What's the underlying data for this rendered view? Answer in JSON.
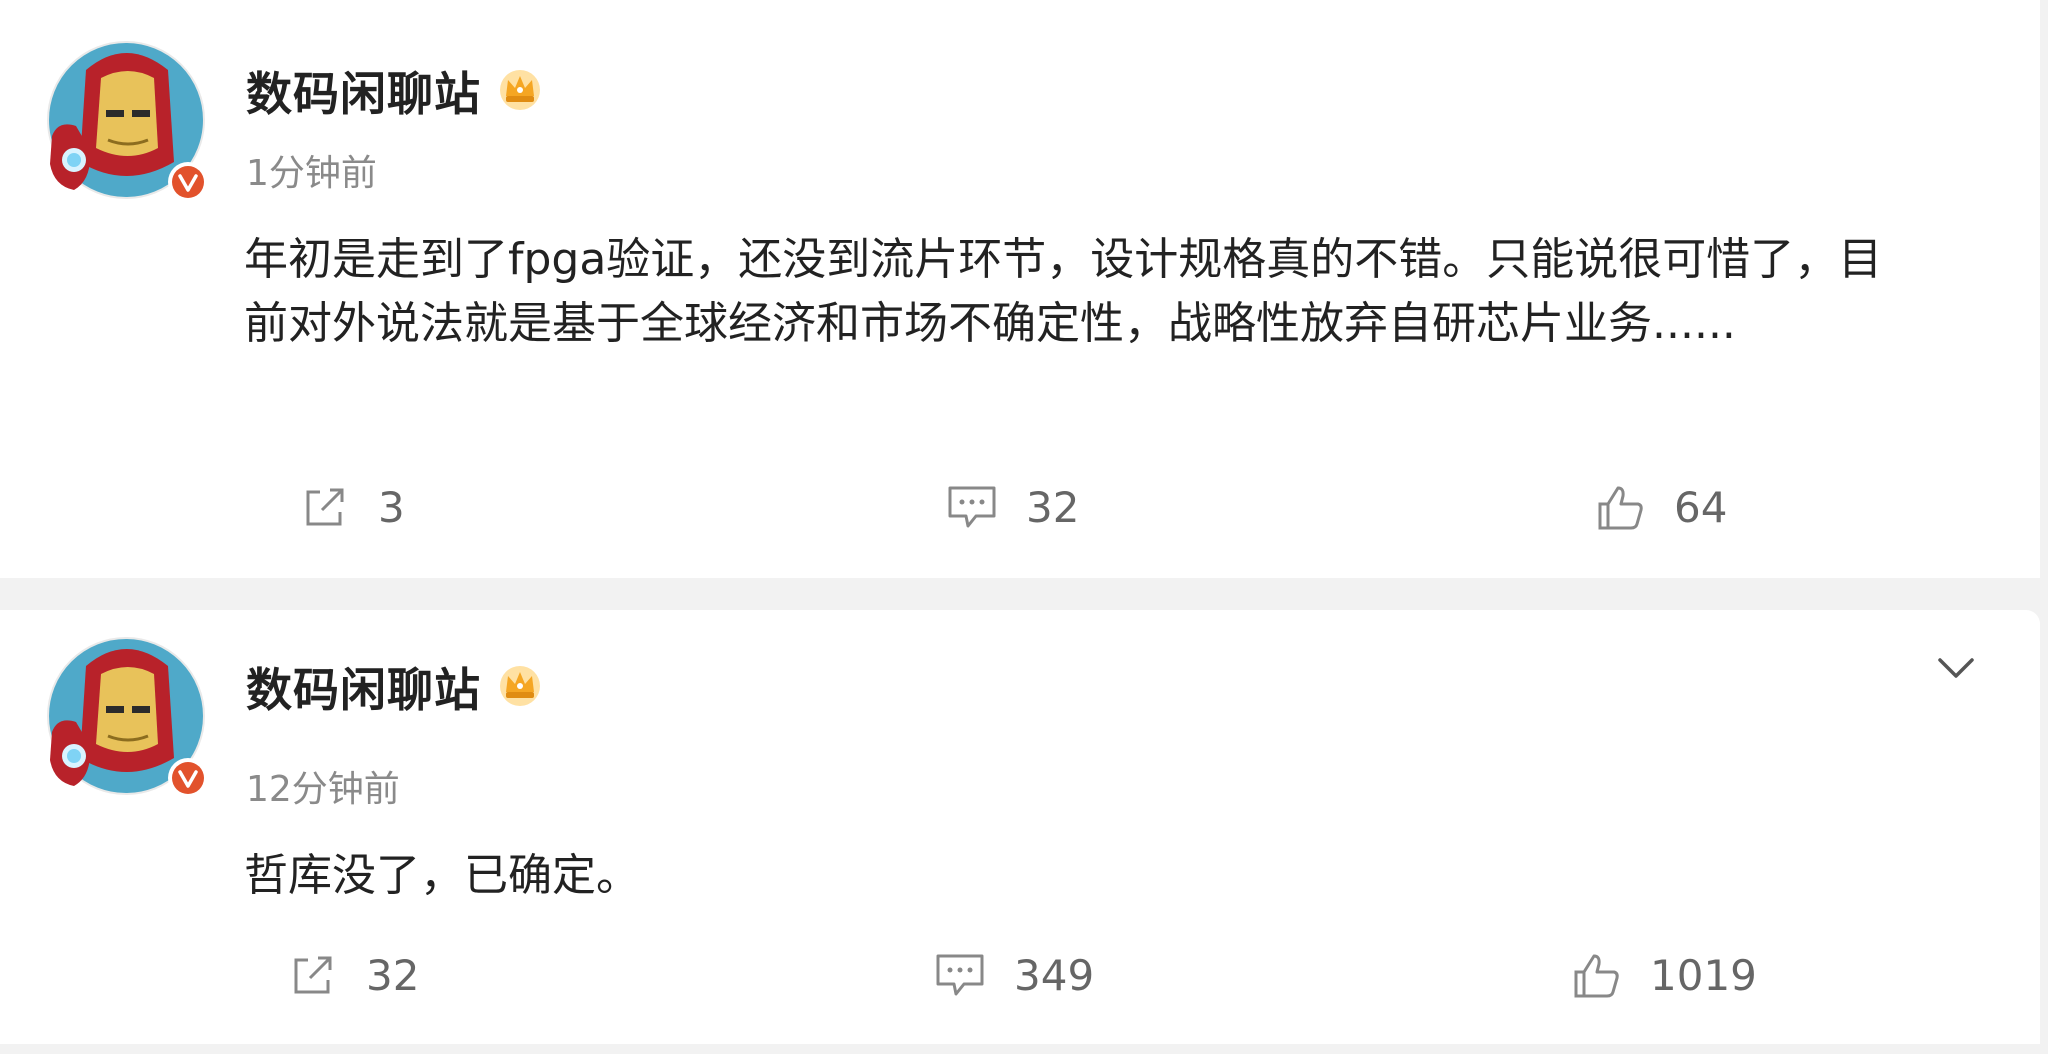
{
  "posts": [
    {
      "username": "数码闲聊站",
      "time": "1分钟前",
      "content": "年初是走到了fpga验证，还没到流片环节，设计规格真的不错。只能说很可惜了，目前对外说法就是基于全球经济和市场不确定性，战略性放弃自研芯片业务......",
      "share_count": "3",
      "comment_count": "32",
      "like_count": "64"
    },
    {
      "username": "数码闲聊站",
      "time": "12分钟前",
      "content": "哲库没了，已确定。",
      "share_count": "32",
      "comment_count": "349",
      "like_count": "1019"
    }
  ],
  "icons": {
    "share": "share-icon",
    "comment": "comment-icon",
    "like": "like-icon",
    "more": "chevron-down-icon",
    "verified": "verified-badge-icon",
    "crown": "crown-badge-icon"
  },
  "colors": {
    "verified_badge": "#e2522c",
    "crown_badge": "#f5a623",
    "icon_gray": "#888888",
    "text_primary": "#222222",
    "text_secondary": "#8a8a8a"
  }
}
